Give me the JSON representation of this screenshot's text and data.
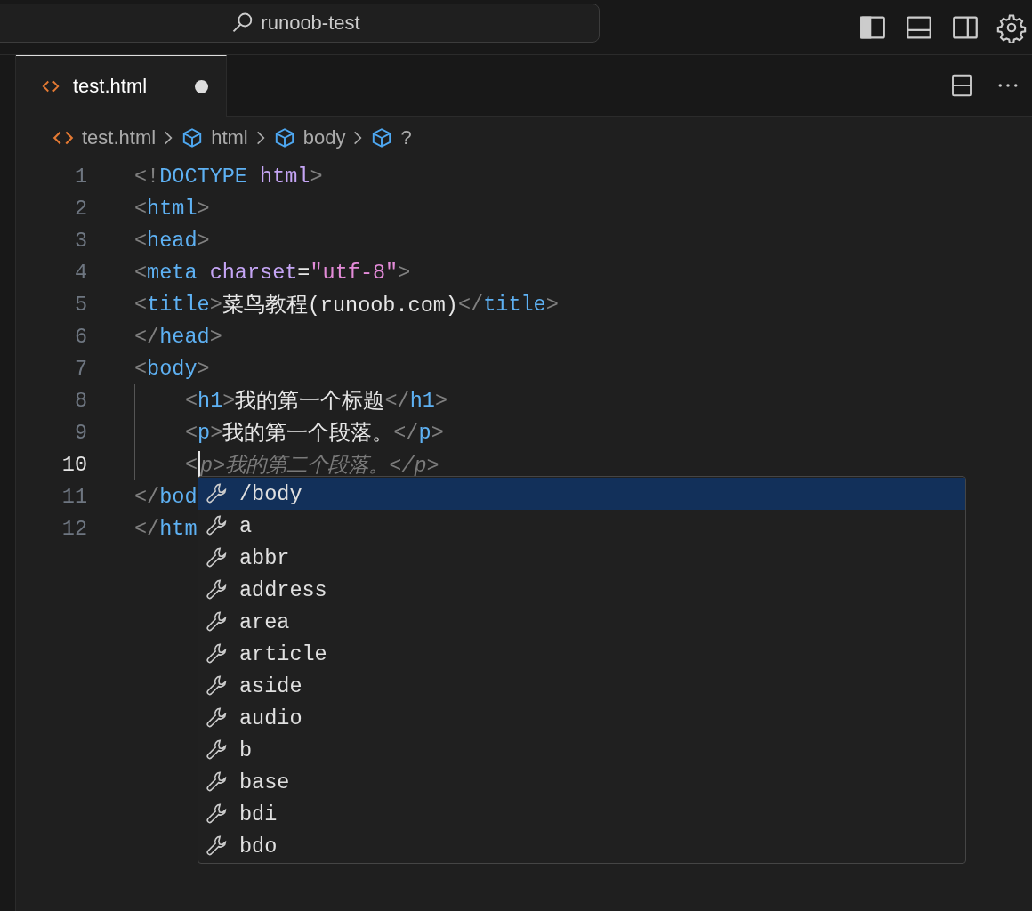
{
  "title_bar": {
    "search": "runoob-test"
  },
  "tabs": [
    {
      "label": "test.html",
      "selected": true,
      "modified": true
    }
  ],
  "breadcrumbs": [
    {
      "label": "test.html",
      "kind": "file"
    },
    {
      "label": "html",
      "kind": "symbol"
    },
    {
      "label": "body",
      "kind": "symbol"
    },
    {
      "label": "?",
      "kind": "symbol"
    }
  ],
  "editor": {
    "lines": [
      {
        "number": "1",
        "active": false,
        "indented": false,
        "tokens": [
          {
            "text": "<!",
            "kind": "punct"
          },
          {
            "text": "DOCTYPE",
            "kind": "tag"
          },
          {
            "text": " html",
            "kind": "attr"
          },
          {
            "text": ">",
            "kind": "punct"
          }
        ]
      },
      {
        "number": "2",
        "active": false,
        "indented": false,
        "tokens": [
          {
            "text": "<",
            "kind": "punct"
          },
          {
            "text": "html",
            "kind": "tag"
          },
          {
            "text": ">",
            "kind": "punct"
          }
        ]
      },
      {
        "number": "3",
        "active": false,
        "indented": false,
        "tokens": [
          {
            "text": "<",
            "kind": "punct"
          },
          {
            "text": "head",
            "kind": "tag"
          },
          {
            "text": ">",
            "kind": "punct"
          }
        ]
      },
      {
        "number": "4",
        "active": false,
        "indented": false,
        "tokens": [
          {
            "text": "<",
            "kind": "punct"
          },
          {
            "text": "meta",
            "kind": "tag"
          },
          {
            "text": " charset",
            "kind": "attr"
          },
          {
            "text": "=",
            "kind": "text"
          },
          {
            "text": "\"utf-8\"",
            "kind": "string"
          },
          {
            "text": ">",
            "kind": "punct"
          }
        ]
      },
      {
        "number": "5",
        "active": false,
        "indented": false,
        "tokens": [
          {
            "text": "<",
            "kind": "punct"
          },
          {
            "text": "title",
            "kind": "tag"
          },
          {
            "text": ">",
            "kind": "punct"
          },
          {
            "text": "菜鸟教程(runoob.com)",
            "kind": "text"
          },
          {
            "text": "</",
            "kind": "punct"
          },
          {
            "text": "title",
            "kind": "tag"
          },
          {
            "text": ">",
            "kind": "punct"
          }
        ]
      },
      {
        "number": "6",
        "active": false,
        "indented": false,
        "tokens": [
          {
            "text": "</",
            "kind": "punct"
          },
          {
            "text": "head",
            "kind": "tag"
          },
          {
            "text": ">",
            "kind": "punct"
          }
        ]
      },
      {
        "number": "7",
        "active": false,
        "indented": false,
        "tokens": [
          {
            "text": "<",
            "kind": "punct"
          },
          {
            "text": "body",
            "kind": "tag"
          },
          {
            "text": ">",
            "kind": "punct"
          }
        ]
      },
      {
        "number": "8",
        "active": false,
        "indented": true,
        "tokens": [
          {
            "text": "<",
            "kind": "punct"
          },
          {
            "text": "h1",
            "kind": "tag"
          },
          {
            "text": ">",
            "kind": "punct"
          },
          {
            "text": "我的第一个标题",
            "kind": "text"
          },
          {
            "text": "</",
            "kind": "punct"
          },
          {
            "text": "h1",
            "kind": "tag"
          },
          {
            "text": ">",
            "kind": "punct"
          }
        ]
      },
      {
        "number": "9",
        "active": false,
        "indented": true,
        "tokens": [
          {
            "text": "<",
            "kind": "punct"
          },
          {
            "text": "p",
            "kind": "tag"
          },
          {
            "text": ">",
            "kind": "punct"
          },
          {
            "text": "我的第一个段落。",
            "kind": "text"
          },
          {
            "text": "</",
            "kind": "punct"
          },
          {
            "text": "p",
            "kind": "tag"
          },
          {
            "text": ">",
            "kind": "punct"
          }
        ]
      },
      {
        "number": "10",
        "active": true,
        "indented": true,
        "tokens": [
          {
            "text": "<",
            "kind": "punct"
          },
          {
            "kind": "cursor"
          },
          {
            "text": "p>我的第二个段落。</p>",
            "kind": "ghost"
          }
        ]
      },
      {
        "number": "11",
        "active": false,
        "indented": false,
        "tokens": [
          {
            "text": "</",
            "kind": "punct"
          },
          {
            "text": "bod",
            "kind": "tag"
          }
        ]
      },
      {
        "number": "12",
        "active": false,
        "indented": false,
        "tokens": [
          {
            "text": "</",
            "kind": "punct"
          },
          {
            "text": "htm",
            "kind": "tag"
          }
        ]
      }
    ],
    "suggestions": [
      {
        "label": "/body",
        "selected": true
      },
      {
        "label": "a",
        "selected": false
      },
      {
        "label": "abbr",
        "selected": false
      },
      {
        "label": "address",
        "selected": false
      },
      {
        "label": "area",
        "selected": false
      },
      {
        "label": "article",
        "selected": false
      },
      {
        "label": "aside",
        "selected": false
      },
      {
        "label": "audio",
        "selected": false
      },
      {
        "label": "b",
        "selected": false
      },
      {
        "label": "base",
        "selected": false
      },
      {
        "label": "bdi",
        "selected": false
      },
      {
        "label": "bdo",
        "selected": false
      }
    ]
  }
}
